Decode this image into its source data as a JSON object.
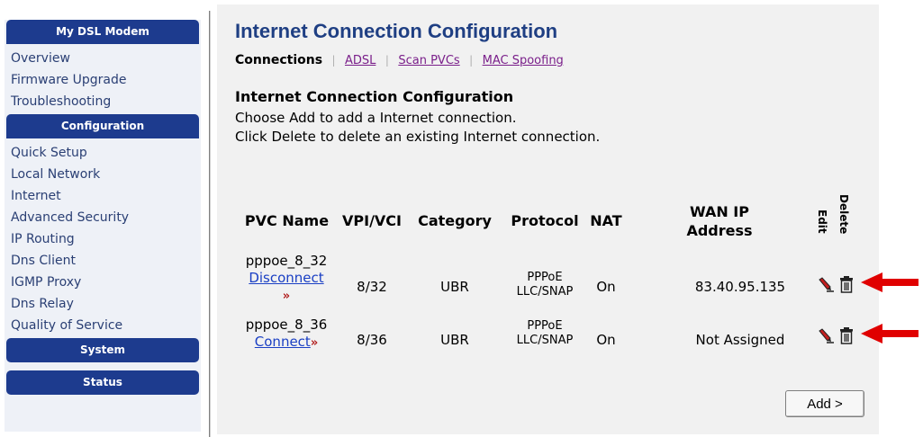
{
  "sidebar": {
    "sections": [
      {
        "header": "My DSL Modem",
        "items": [
          "Overview",
          "Firmware Upgrade",
          "Troubleshooting"
        ]
      },
      {
        "header": "Configuration",
        "items": [
          "Quick Setup",
          "Local Network",
          "Internet",
          "Advanced Security",
          "IP Routing",
          "Dns Client",
          "IGMP Proxy",
          "Dns Relay",
          "Quality of Service"
        ]
      },
      {
        "header": "System",
        "items": []
      },
      {
        "header": "Status",
        "items": []
      }
    ]
  },
  "main": {
    "title": "Internet Connection Configuration",
    "tabs": {
      "active": "Connections",
      "links": [
        "ADSL",
        "Scan PVCs",
        "MAC Spoofing"
      ]
    },
    "section_title": "Internet Connection Configuration",
    "instructions": [
      "Choose Add to add a Internet connection.",
      "Click Delete to delete an existing Internet connection."
    ],
    "table": {
      "headers": {
        "pvc_name": "PVC Name",
        "vpi_vci": "VPI/VCI",
        "category": "Category",
        "protocol": "Protocol",
        "nat": "NAT",
        "wan_ip_line1": "WAN IP",
        "wan_ip_line2": "Address",
        "edit": "Edit",
        "delete": "Delete"
      },
      "rows": [
        {
          "name": "pppoe_8_32",
          "action": "Disconnect",
          "action_suffix": "»",
          "vpi_vci": "8/32",
          "category": "UBR",
          "protocol_line1": "PPPoE",
          "protocol_line2": "LLC/SNAP",
          "nat": "On",
          "wan_ip": "83.40.95.135"
        },
        {
          "name": "pppoe_8_36",
          "action": "Connect",
          "action_suffix": "»",
          "vpi_vci": "8/36",
          "category": "UBR",
          "protocol_line1": "PPPoE",
          "protocol_line2": "LLC/SNAP",
          "nat": "On",
          "wan_ip": "Not Assigned"
        }
      ]
    },
    "add_button": "Add >"
  },
  "icons": {
    "edit": "pencil-icon",
    "delete": "trash-icon",
    "annotation": "red-arrow-icon"
  },
  "colors": {
    "nav_header": "#1d3b8e",
    "title": "#1f3f83",
    "link_visited": "#7a1f8a",
    "link": "#1a3fc4",
    "arrow": "#e00000"
  }
}
